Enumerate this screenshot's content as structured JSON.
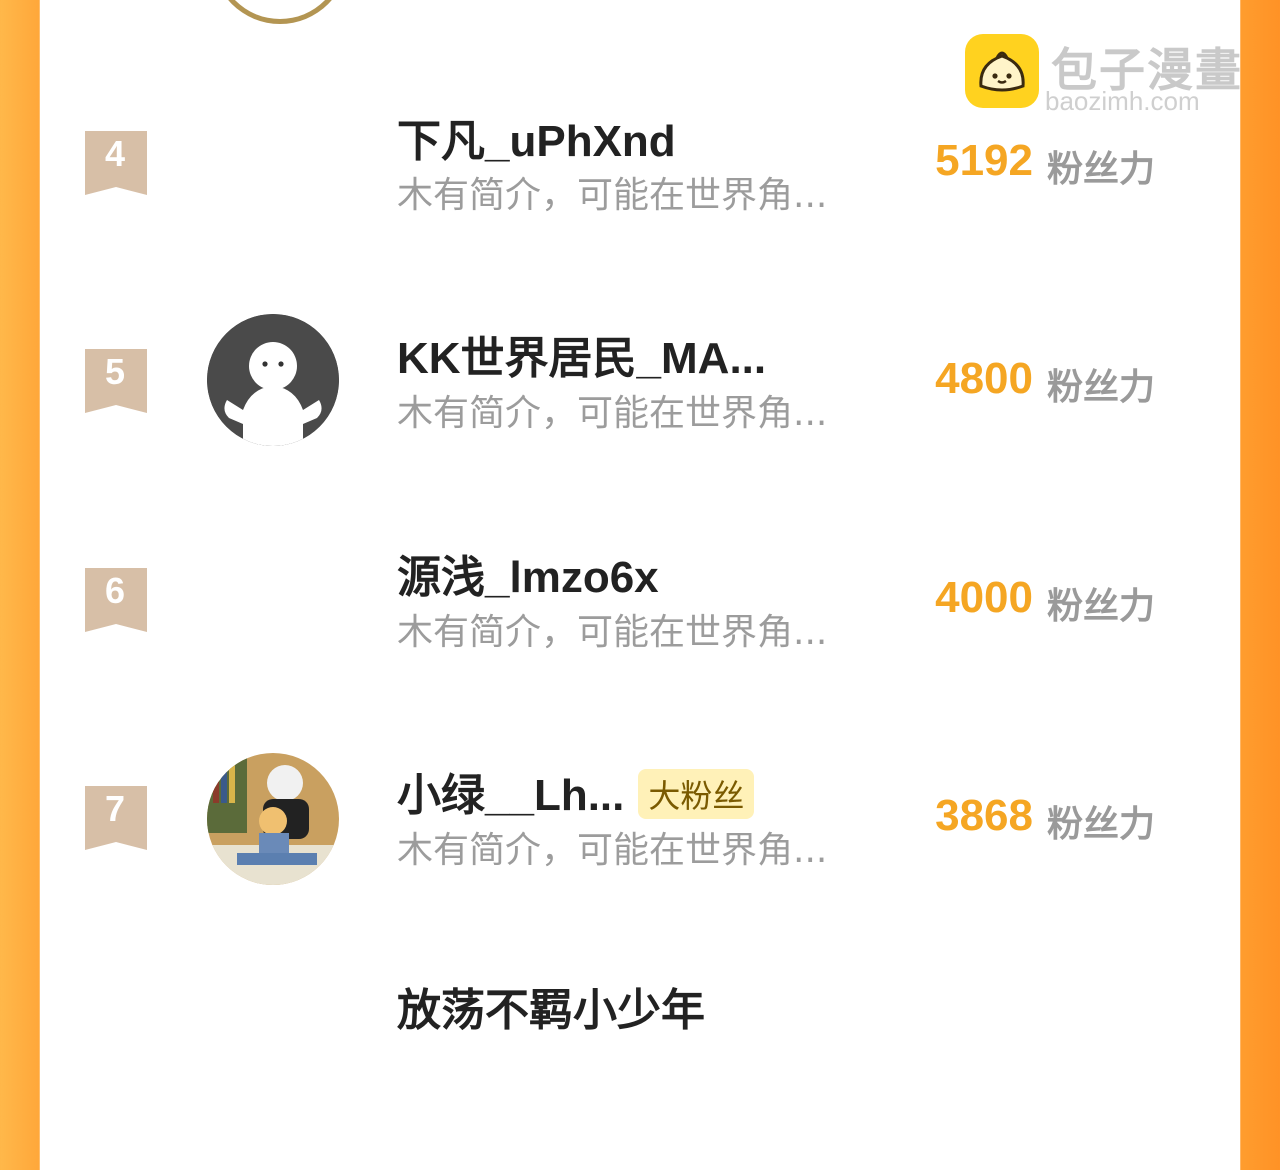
{
  "watermark": {
    "title": "包子漫畫",
    "domain": "baozimh.com"
  },
  "unit": "粉丝力",
  "rows": [
    {
      "rank": "4",
      "name": "下凡_uPhXnd",
      "bio": "木有简介，可能在世界角...",
      "score": "5192",
      "badge": ""
    },
    {
      "rank": "5",
      "name": "KK世界居民_MA...",
      "bio": "木有简介，可能在世界角...",
      "score": "4800",
      "badge": ""
    },
    {
      "rank": "6",
      "name": "源浅_lmzo6x",
      "bio": "木有简介，可能在世界角...",
      "score": "4000",
      "badge": ""
    },
    {
      "rank": "7",
      "name": "小绿__Lh...",
      "bio": "木有简介，可能在世界角...",
      "score": "3868",
      "badge": "大粉丝"
    },
    {
      "rank": "",
      "name": "放荡不羁小少年",
      "bio": "",
      "score": "",
      "badge": ""
    }
  ],
  "colors": {
    "accent": "#f5a623",
    "badge_bg": "#d7bfa7",
    "side_orange": "#ffa73a"
  }
}
